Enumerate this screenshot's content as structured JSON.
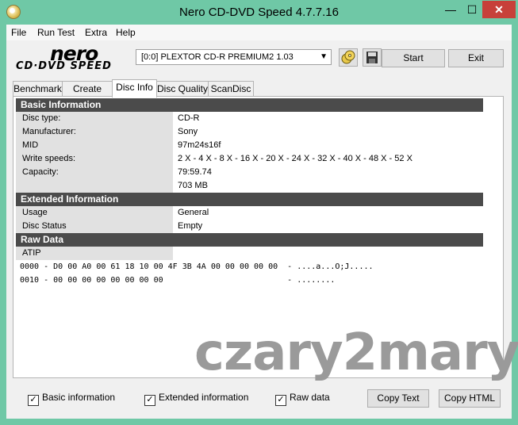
{
  "window": {
    "title": "Nero CD-DVD Speed 4.7.7.16",
    "minimize_glyph": "—",
    "maximize_glyph": "☐",
    "close_glyph": "✕"
  },
  "menu": [
    "File",
    "Run Test",
    "Extra",
    "Help"
  ],
  "logo": {
    "top": "nero",
    "bottom": "CD·DVD SPEED"
  },
  "drive": {
    "selected": "[0:0]  PLEXTOR CD-R   PREMIUM2 1.03"
  },
  "toolbar": {
    "start_label": "Start",
    "exit_label": "Exit"
  },
  "tabs": [
    "Benchmark",
    "Create Disc",
    "Disc Info",
    "Disc Quality",
    "ScanDisc"
  ],
  "active_tab": "Disc Info",
  "basic_info": {
    "header": "Basic Information",
    "rows": [
      {
        "label": "Disc type:",
        "value": "CD-R"
      },
      {
        "label": "Manufacturer:",
        "value": "Sony"
      },
      {
        "label": "MID",
        "value": "97m24s16f"
      },
      {
        "label": "Write speeds:",
        "value": "2 X - 4 X - 8 X - 16 X - 20 X - 24 X - 32 X - 40 X - 48 X - 52 X"
      },
      {
        "label": "Capacity:",
        "value": "79:59.74"
      },
      {
        "label": "",
        "value": "703 MB"
      }
    ]
  },
  "extended_info": {
    "header": "Extended Information",
    "rows": [
      {
        "label": "Usage",
        "value": "General"
      },
      {
        "label": "Disc Status",
        "value": "Empty"
      }
    ]
  },
  "raw_data": {
    "header": "Raw Data",
    "atip_label": "ATIP",
    "lines": [
      "0000 - D0 00 A0 00 61 18 10 00 4F 3B 4A 00 00 00 00 00  - ....a...O;J.....",
      "0010 - 00 00 00 00 00 00 00 00                          - ........"
    ]
  },
  "watermark": "czary2mary",
  "footer": {
    "basic_info_label": "Basic information",
    "extended_info_label": "Extended information",
    "raw_data_label": "Raw data",
    "copy_text_label": "Copy Text",
    "copy_html_label": "Copy HTML",
    "check_glyph": "✓"
  }
}
